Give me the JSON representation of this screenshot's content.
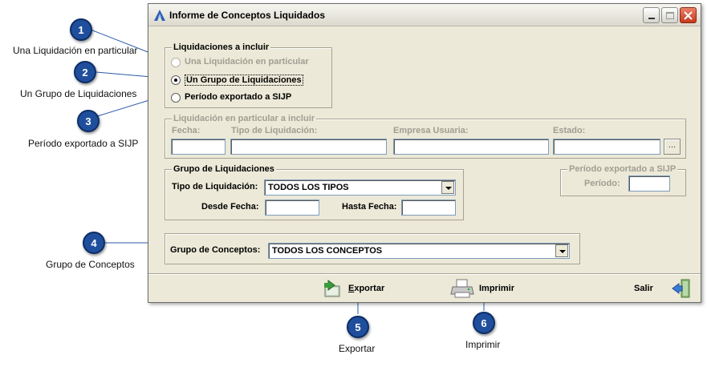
{
  "window": {
    "title": "Informe de Conceptos Liquidados"
  },
  "liquidaciones_incluir": {
    "legend": "Liquidaciones a incluir",
    "options": [
      {
        "label": "Una Liquidación en particular",
        "checked": false,
        "enabled": false
      },
      {
        "label": "Un Grupo de Liquidaciones",
        "checked": true,
        "enabled": true
      },
      {
        "label": "Período exportado a SIJP",
        "checked": false,
        "enabled": true
      }
    ]
  },
  "liquidacion_particular": {
    "legend": "Liquidación en particular a incluir",
    "fecha_label": "Fecha:",
    "tipo_label": "Tipo de Liquidación:",
    "empresa_label": "Empresa Usuaria:",
    "estado_label": "Estado:",
    "browse_label": "..."
  },
  "grupo_liquidaciones": {
    "legend": "Grupo de Liquidaciones",
    "tipo_label": "Tipo de Liquidación:",
    "tipo_value": "TODOS LOS TIPOS",
    "desde_label": "Desde Fecha:",
    "hasta_label": "Hasta Fecha:"
  },
  "periodo_sijp": {
    "legend": "Período exportado a SIJP",
    "periodo_label": "Período:"
  },
  "grupo_conceptos": {
    "label": "Grupo de Conceptos:",
    "value": "TODOS LOS CONCEPTOS"
  },
  "actions": {
    "exportar_first": "E",
    "exportar_rest": "xportar",
    "imprimir": "Imprimir",
    "salir": "Salir"
  },
  "annotations": [
    {
      "number": "1",
      "text": "Una Liquidación en particular"
    },
    {
      "number": "2",
      "text": "Un Grupo de Liquidaciones"
    },
    {
      "number": "3",
      "text": "Período exportado a SIJP"
    },
    {
      "number": "4",
      "text": "Grupo de Conceptos"
    },
    {
      "number": "5",
      "text": "Exportar"
    },
    {
      "number": "6",
      "text": "Imprimir"
    }
  ],
  "colors": {
    "badge": "#1f4f9c",
    "window_bg": "#ece9d8",
    "close_button": "#c8381c"
  }
}
